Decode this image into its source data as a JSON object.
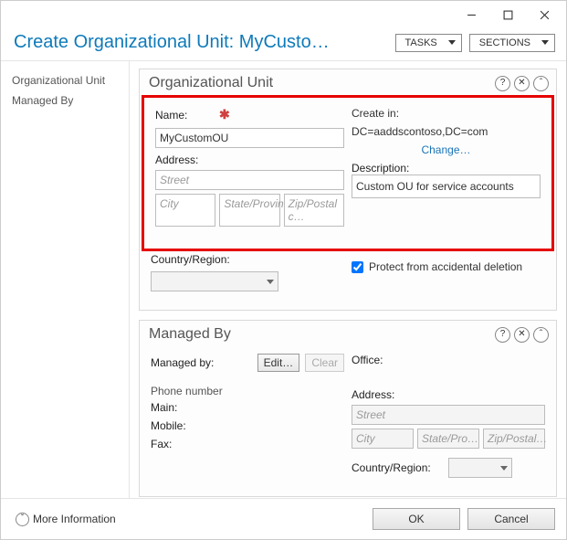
{
  "window": {
    "title": "Create Organizational Unit: MyCusto…",
    "tasks_btn": "TASKS",
    "sections_btn": "SECTIONS"
  },
  "sidebar": {
    "items": [
      {
        "label": "Organizational Unit"
      },
      {
        "label": "Managed By"
      }
    ]
  },
  "ou_section": {
    "title": "Organizational Unit",
    "name_label": "Name:",
    "name_value": "MyCustomOU",
    "address_label": "Address:",
    "street_ph": "Street",
    "city_ph": "City",
    "state_ph": "State/Provin…",
    "zip_ph": "Zip/Postal c…",
    "country_label": "Country/Region:",
    "create_in_label": "Create in:",
    "create_in_value": "DC=aaddscontoso,DC=com",
    "change_link": "Change…",
    "description_label": "Description:",
    "description_value": "Custom OU for service accounts",
    "protect_label": "Protect from accidental deletion"
  },
  "mb_section": {
    "title": "Managed By",
    "managed_by_label": "Managed by:",
    "edit_btn": "Edit…",
    "clear_btn": "Clear",
    "phone_header": "Phone number",
    "main_label": "Main:",
    "mobile_label": "Mobile:",
    "fax_label": "Fax:",
    "office_label": "Office:",
    "address_label": "Address:",
    "street_ph": "Street",
    "city_ph": "City",
    "state_ph": "State/Pro…",
    "zip_ph": "Zip/Postal…",
    "country_label": "Country/Region:"
  },
  "footer": {
    "more_info": "More Information",
    "ok": "OK",
    "cancel": "Cancel"
  }
}
